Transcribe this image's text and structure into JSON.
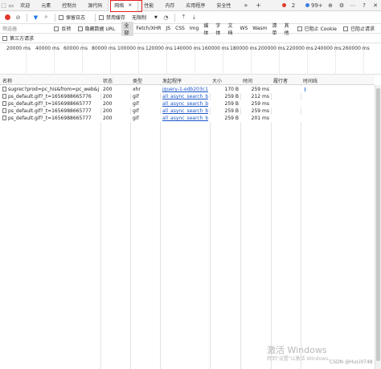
{
  "tabs": [
    {
      "label": "欢迎"
    },
    {
      "label": "元素"
    },
    {
      "label": "控制台"
    },
    {
      "label": "源代码"
    },
    {
      "label": "网络",
      "active": true,
      "close": "×"
    },
    {
      "label": "性能"
    },
    {
      "label": "内存"
    },
    {
      "label": "应用程序"
    },
    {
      "label": "安全性"
    }
  ],
  "tab_more": "»",
  "tab_add": "+",
  "badges": {
    "errors": "2",
    "issues": "99+",
    "error_color": "#e0382b",
    "issue_color": "#3b7de0"
  },
  "toolbar": {
    "preserve_log": "保留日志",
    "disable_cache": "禁用缓存",
    "throttle": "无限制"
  },
  "filter": {
    "placeholder": "筛选器",
    "invert": "反转",
    "hide_data_urls": "隐藏数据 URL",
    "types": [
      "全部",
      "Fetch/XHR",
      "JS",
      "CSS",
      "Img",
      "媒体",
      "字体",
      "文档",
      "WS",
      "Wasm",
      "清单",
      "其他"
    ],
    "blocked_cookies": "已阻止 Cookie",
    "blocked_requests": "已阻止请求",
    "third_party": "第三方请求"
  },
  "overview_ticks": [
    "20000 ms",
    "40000 ms",
    "60000 ms",
    "80000 ms",
    "100000 ms",
    "120000 ms",
    "140000 ms",
    "160000 ms",
    "180000 ms",
    "200000 ms",
    "220000 ms",
    "240000 ms",
    "260000 ms"
  ],
  "columns": {
    "name": "名称",
    "status": "状态",
    "type": "类型",
    "initiator": "发起程序",
    "size": "大小",
    "time": "时间",
    "priority": "履行者",
    "waterfall": "时间线"
  },
  "rows": [
    {
      "name": "sugrec?prod=pc_his&from=pc_web&jso...",
      "status": "200",
      "type": "xhr",
      "initiator": "jquery-1-edb203c1...",
      "size": "170 B",
      "time": "259 ms"
    },
    {
      "name": "ps_default.gif?_t=1656988665776",
      "status": "200",
      "type": "gif",
      "initiator": "all_async_search_bc...",
      "size": "259 B",
      "time": "212 ms"
    },
    {
      "name": "ps_default.gif?_t=1656988665777",
      "status": "200",
      "type": "gif",
      "initiator": "all_async_search_bc...",
      "size": "259 B",
      "time": "259 ms"
    },
    {
      "name": "ps_default.gif?_t=1656988665777",
      "status": "200",
      "type": "gif",
      "initiator": "all_async_search_bc...",
      "size": "259 B",
      "time": "259 ms"
    },
    {
      "name": "ps_default.gif?_t=1656988665777",
      "status": "200",
      "type": "gif",
      "initiator": "all_async_search_bc...",
      "size": "259 B",
      "time": "201 ms"
    }
  ],
  "watermark": {
    "title": "激活 Windows",
    "subtitle": "转到\"设置\"以激活 Windows。"
  },
  "credit": "CSDN @HuLi0748"
}
